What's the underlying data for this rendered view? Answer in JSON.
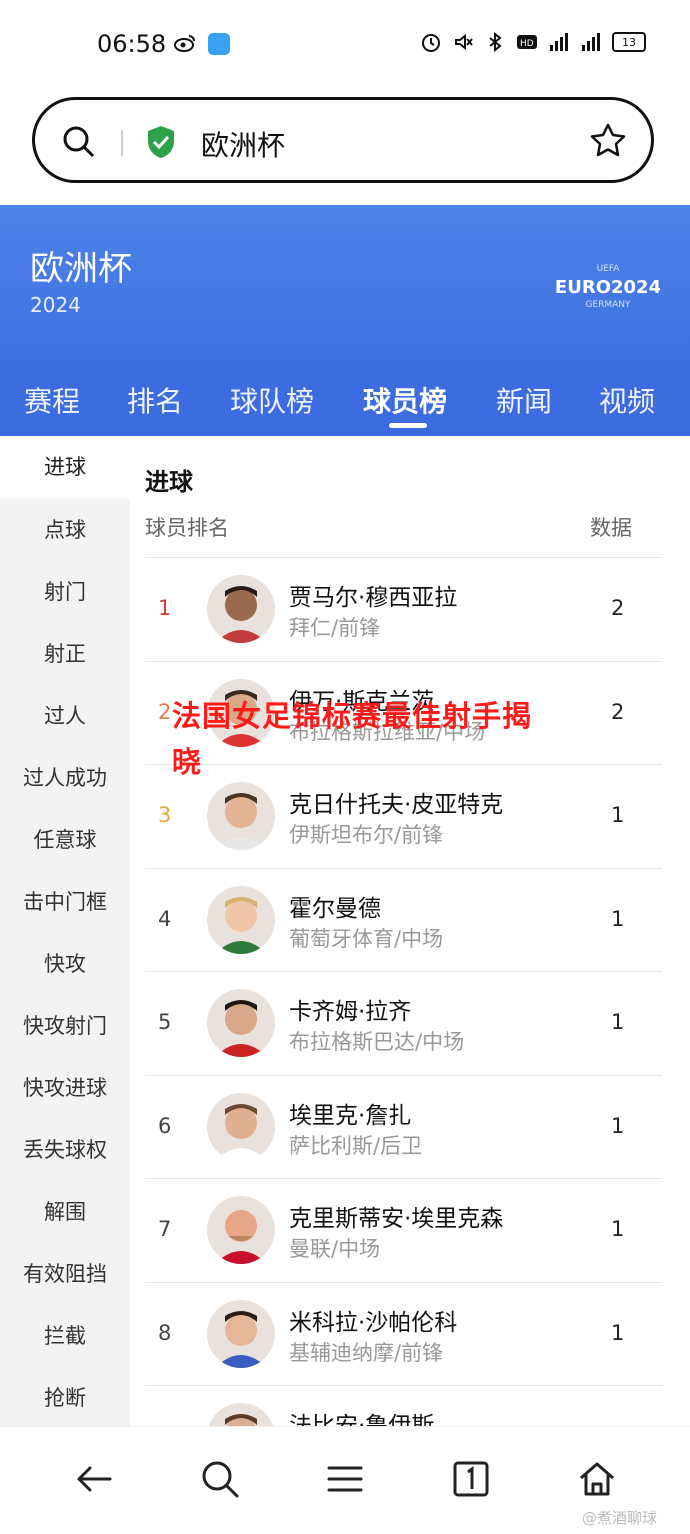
{
  "status_bar": {
    "time": "06:58",
    "battery": "13"
  },
  "search": {
    "query": "欧洲杯"
  },
  "header": {
    "title": "欧洲杯",
    "year": "2024",
    "logo_text": "EURO2024",
    "logo_sub": "GERMANY",
    "logo_top": "UEFA"
  },
  "tabs": [
    {
      "label": "赛程"
    },
    {
      "label": "排名"
    },
    {
      "label": "球队榜"
    },
    {
      "label": "球员榜",
      "active": true
    },
    {
      "label": "新闻"
    },
    {
      "label": "视频"
    }
  ],
  "side_menu": [
    {
      "label": "进球",
      "active": true
    },
    {
      "label": "点球"
    },
    {
      "label": "射门"
    },
    {
      "label": "射正"
    },
    {
      "label": "过人"
    },
    {
      "label": "过人成功"
    },
    {
      "label": "任意球"
    },
    {
      "label": "击中门框"
    },
    {
      "label": "快攻"
    },
    {
      "label": "快攻射门"
    },
    {
      "label": "快攻进球"
    },
    {
      "label": "丢失球权"
    },
    {
      "label": "解围"
    },
    {
      "label": "有效阻挡"
    },
    {
      "label": "拦截"
    },
    {
      "label": "抢断"
    }
  ],
  "main": {
    "title": "进球",
    "col_rank": "球员排名",
    "col_data": "数据",
    "players": [
      {
        "rank": "1",
        "name": "贾马尔·穆西亚拉",
        "team": "拜仁/前锋",
        "value": "2"
      },
      {
        "rank": "2",
        "name": "伊万·斯克兰茨",
        "team": "布拉格斯拉维亚/中场",
        "value": "2"
      },
      {
        "rank": "3",
        "name": "克日什托夫·皮亚特克",
        "team": "伊斯坦布尔/前锋",
        "value": "1"
      },
      {
        "rank": "4",
        "name": "霍尔曼德",
        "team": "葡萄牙体育/中场",
        "value": "1"
      },
      {
        "rank": "5",
        "name": "卡齐姆·拉齐",
        "team": "布拉格斯巴达/中场",
        "value": "1"
      },
      {
        "rank": "6",
        "name": "埃里克·詹扎",
        "team": "萨比利斯/后卫",
        "value": "1"
      },
      {
        "rank": "7",
        "name": "克里斯蒂安·埃里克森",
        "team": "曼联/中场",
        "value": "1"
      },
      {
        "rank": "8",
        "name": "米科拉·沙帕伦科",
        "team": "基辅迪纳摩/前锋",
        "value": "1"
      },
      {
        "rank": "",
        "name": "法比安·鲁伊斯",
        "team": "",
        "value": ""
      }
    ]
  },
  "overlay_text": "法国女足锦标赛最佳射手揭晓",
  "watermark": "@煮酒聊球",
  "colors": {
    "header_blue": "#4f84ea",
    "tab_blue": "#3c6ce0",
    "rank1": "#d73a3a",
    "rank3": "#e2a83d",
    "overlay": "#ff1a1a"
  }
}
